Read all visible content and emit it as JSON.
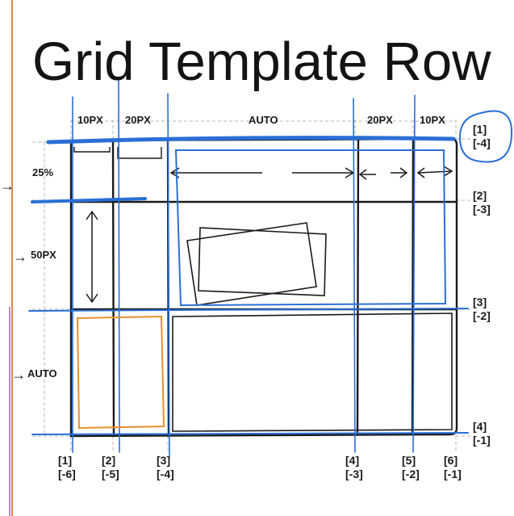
{
  "title": "Grid Template Row",
  "column_sizes": [
    "10PX",
    "20PX",
    "AUTO",
    "20PX",
    "10PX"
  ],
  "row_sizes": [
    "25%",
    "50PX",
    "AUTO"
  ],
  "row_line_numbers": [
    {
      "pos": "[1]",
      "neg": "[-4]"
    },
    {
      "pos": "[2]",
      "neg": "[-3]"
    },
    {
      "pos": "[3]",
      "neg": "[-2]"
    },
    {
      "pos": "[4]",
      "neg": "[-1]"
    }
  ],
  "column_line_numbers": [
    {
      "pos": "[1]",
      "neg": "[-6]"
    },
    {
      "pos": "[2]",
      "neg": "[-5]"
    },
    {
      "pos": "[3]",
      "neg": "[-4]"
    },
    {
      "pos": "[4]",
      "neg": "[-3]"
    },
    {
      "pos": "[5]",
      "neg": "[-2]"
    },
    {
      "pos": "[6]",
      "neg": "[-1]"
    }
  ],
  "colors": {
    "ink": "#1a1a1a",
    "blue_pen": "#2a6fd6",
    "orange_pen": "#e8902a",
    "margin_line": "#e8834a",
    "dashed_guide": "#b5b5b5"
  }
}
